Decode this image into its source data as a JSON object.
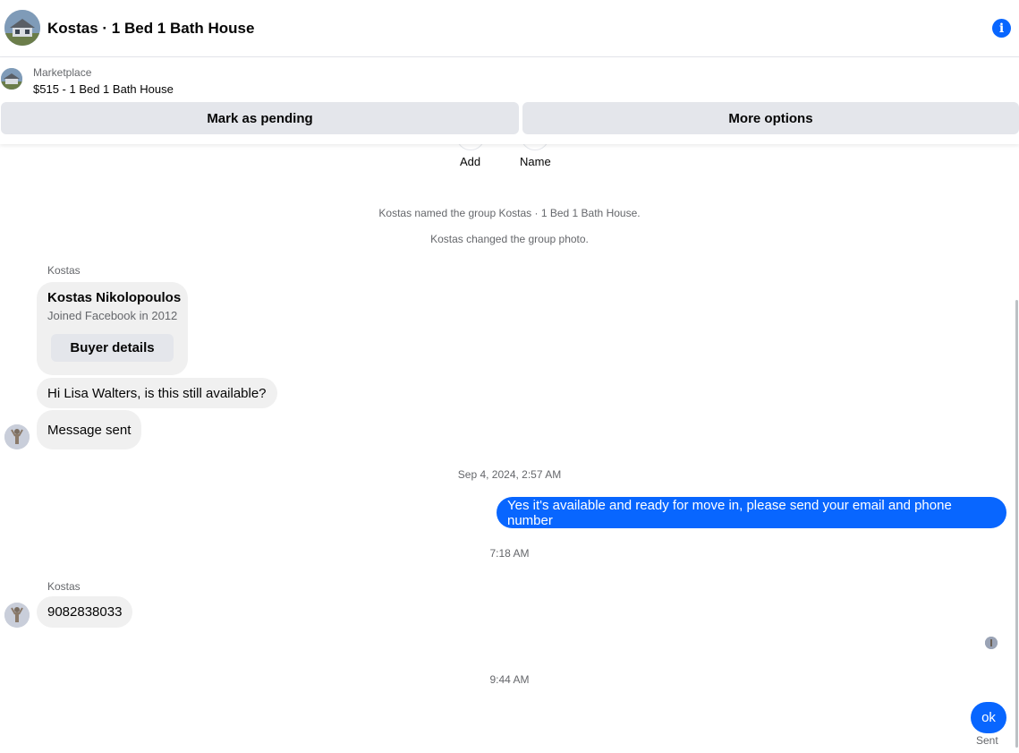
{
  "header": {
    "title": "Kostas · 1 Bed 1 Bath House"
  },
  "marketplace": {
    "label": "Marketplace",
    "listing": "$515 - 1 Bed 1 Bath House",
    "pending_button": "Mark as pending",
    "more_button": "More options"
  },
  "actions": {
    "add_label": "Add",
    "name_label": "Name"
  },
  "system_messages": [
    "Kostas named the group Kostas · 1 Bed 1 Bath House.",
    "Kostas changed the group photo."
  ],
  "buyer_card": {
    "sender": "Kostas",
    "name": "Kostas Nikolopoulos",
    "joined": "Joined Facebook in 2012",
    "button": "Buyer details"
  },
  "messages": {
    "m1": "Hi Lisa Walters, is this still available?",
    "m2": "Message sent",
    "ts1": "Sep 4, 2024, 2:57 AM",
    "m3": "Yes it's available and ready for move in, please send your email and phone number",
    "ts2": "7:18 AM",
    "sender2": "Kostas",
    "m4": "9082838033",
    "ts3": "9:44 AM",
    "m5": "ok",
    "status": "Sent"
  },
  "colors": {
    "accent": "#0866ff",
    "bubble_in": "#f0f0f0",
    "button_bg": "#e4e6eb"
  }
}
